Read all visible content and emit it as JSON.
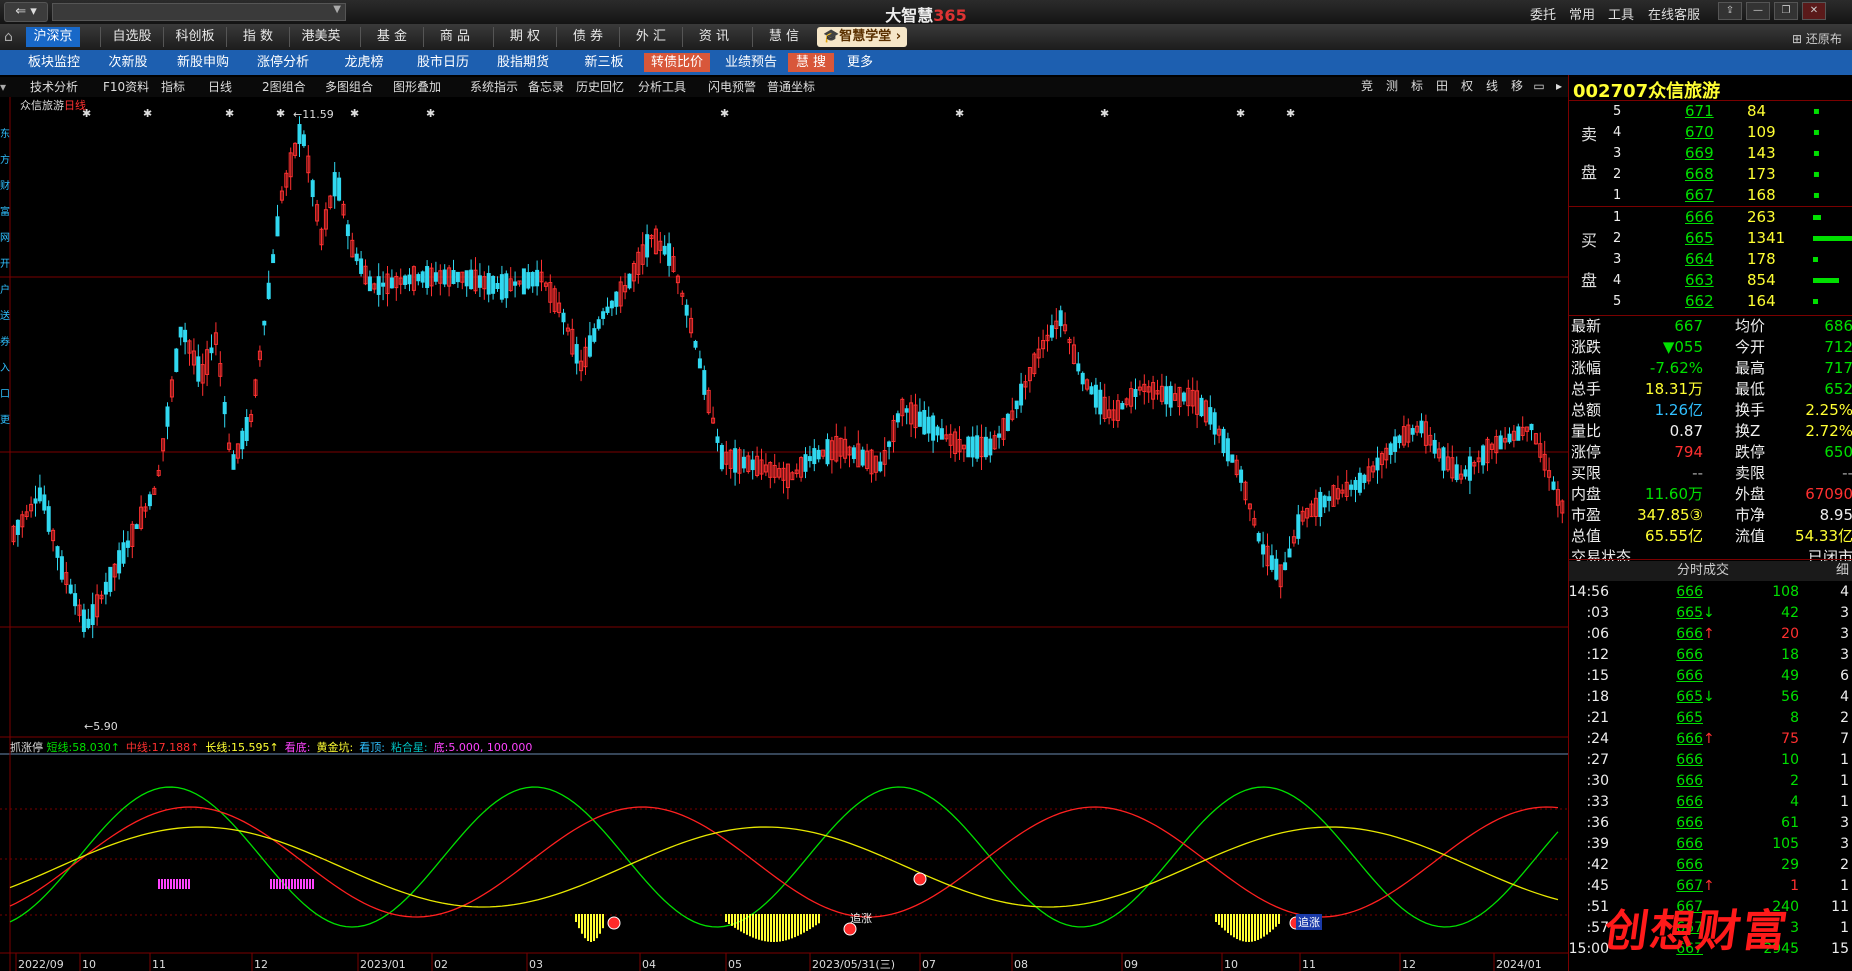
{
  "titlebar": {
    "app_name_prefix": "大智慧",
    "app_name_num": "365",
    "right_links": [
      "委托",
      "常用",
      "工具",
      "在线客服"
    ],
    "layout_btn": "还原布局"
  },
  "mainmenu": {
    "items": [
      "沪深京",
      "自选股",
      "科创板",
      "指 数",
      "港美英",
      "基 金",
      "商 品",
      "期 权",
      "债 券",
      "外 汇",
      "资 讯",
      "慧 信"
    ],
    "edu": "智慧学堂"
  },
  "submenu": {
    "items": [
      "板块监控",
      "次新股",
      "新股申购",
      "涨停分析",
      "龙虎榜",
      "股市日历",
      "股指期货",
      "新三板",
      "转债比价",
      "业绩预告",
      "慧 搜",
      "更多"
    ]
  },
  "toolbar": {
    "items": [
      "技术分析",
      "F10资料",
      "指标",
      "日线",
      "2图组合",
      "多图组合",
      "图形叠加",
      "系统指示",
      "备忘录",
      "历史回忆",
      "分析工具",
      "闪电预警",
      "普通坐标"
    ],
    "right_items": [
      "竞",
      "测",
      "标",
      "田",
      "权",
      "线",
      "移"
    ]
  },
  "chart": {
    "stock_name": "众信旅游",
    "period": "日线",
    "high_label": "11.59",
    "low_label": "5.90",
    "indicator_name": "抓涨停",
    "indicator_items": [
      {
        "label": "短线:",
        "value": "58.030↑",
        "color": "#00e000"
      },
      {
        "label": "中线:",
        "value": "17.188↑",
        "color": "#ff3030"
      },
      {
        "label": "长线:",
        "value": "15.595↑",
        "color": "#ffff33"
      },
      {
        "label": "看底:",
        "value": "",
        "color": "#ff44ff"
      },
      {
        "label": "黄金坑:",
        "value": "",
        "color": "#ffff33"
      },
      {
        "label": "看顶:",
        "value": "",
        "color": "#30c0ff"
      },
      {
        "label": "粘合星:",
        "value": "",
        "color": "#00c0c0"
      },
      {
        "label": "底:",
        "value": "5.000, 100.000",
        "color": "#ff44ff"
      }
    ],
    "annotations": [
      "追涨",
      "追涨"
    ],
    "date_labels": [
      "2022/09",
      "10",
      "11",
      "12",
      "2023/01",
      "02",
      "03",
      "04",
      "05",
      "2023/05/31(三)",
      "07",
      "08",
      "09",
      "10",
      "11",
      "12",
      "2024/01"
    ],
    "left_axis_fragments": [
      "东",
      "方",
      "财",
      "富",
      "网",
      "开",
      "户",
      "送",
      "券",
      "入",
      "口",
      "更"
    ]
  },
  "quote": {
    "code": "002707",
    "name": "众信旅游",
    "sell_label": [
      "卖",
      "盘"
    ],
    "buy_label": [
      "买",
      "盘"
    ],
    "sell": [
      {
        "lvl": "5",
        "price": "671",
        "vol": "84"
      },
      {
        "lvl": "4",
        "price": "670",
        "vol": "109"
      },
      {
        "lvl": "3",
        "price": "669",
        "vol": "143"
      },
      {
        "lvl": "2",
        "price": "668",
        "vol": "173"
      },
      {
        "lvl": "1",
        "price": "667",
        "vol": "168"
      }
    ],
    "buy": [
      {
        "lvl": "1",
        "price": "666",
        "vol": "263",
        "bar": 0.2
      },
      {
        "lvl": "2",
        "price": "665",
        "vol": "1341",
        "bar": 1.0
      },
      {
        "lvl": "3",
        "price": "664",
        "vol": "178",
        "bar": 0.13
      },
      {
        "lvl": "4",
        "price": "663",
        "vol": "854",
        "bar": 0.64
      },
      {
        "lvl": "5",
        "price": "662",
        "vol": "164",
        "bar": 0.12
      }
    ],
    "stats": [
      {
        "l1": "最新",
        "v1": "667",
        "c1": "green",
        "l2": "均价",
        "v2": "686",
        "c2": "green"
      },
      {
        "l1": "涨跌",
        "v1": "▼055",
        "c1": "green",
        "l2": "今开",
        "v2": "712",
        "c2": "green"
      },
      {
        "l1": "涨幅",
        "v1": "-7.62%",
        "c1": "green",
        "l2": "最高",
        "v2": "717",
        "c2": "green"
      },
      {
        "l1": "总手",
        "v1": "18.31万",
        "c1": "yellow",
        "l2": "最低",
        "v2": "652",
        "c2": "green"
      },
      {
        "l1": "总额",
        "v1": "1.26亿",
        "c1": "cyan",
        "l2": "换手",
        "v2": "2.25%",
        "c2": "yellow"
      },
      {
        "l1": "量比",
        "v1": "0.87",
        "c1": "white",
        "l2": "换Z",
        "v2": "2.72%",
        "c2": "yellow"
      },
      {
        "l1": "涨停",
        "v1": "794",
        "c1": "red",
        "l2": "跌停",
        "v2": "650",
        "c2": "green"
      },
      {
        "l1": "买限",
        "v1": "--",
        "c1": "gray",
        "l2": "卖限",
        "v2": "--",
        "c2": "gray"
      },
      {
        "l1": "内盘",
        "v1": "11.60万",
        "c1": "green",
        "l2": "外盘",
        "v2": "67090",
        "c2": "red"
      },
      {
        "l1": "市盈",
        "v1": "347.85③",
        "c1": "yellow",
        "l2": "市净",
        "v2": "8.95",
        "c2": "white"
      },
      {
        "l1": "总值",
        "v1": "65.55亿",
        "c1": "yellow",
        "l2": "流值",
        "v2": "54.33亿",
        "c2": "yellow"
      },
      {
        "l1": "交易状态",
        "v1": "",
        "c1": "white",
        "l2": "",
        "v2": "已闭市",
        "c2": "white"
      }
    ],
    "ticks_header": "分时成交",
    "ticks_tab": "细",
    "ticks": [
      {
        "t": "14:56",
        "p": "666",
        "d": "",
        "v": "108",
        "vc": "green",
        "n": "4"
      },
      {
        "t": ":03",
        "p": "665",
        "d": "↓",
        "v": "42",
        "vc": "green",
        "n": "3"
      },
      {
        "t": ":06",
        "p": "666",
        "d": "↑",
        "v": "20",
        "vc": "red",
        "n": "3"
      },
      {
        "t": ":12",
        "p": "666",
        "d": "",
        "v": "18",
        "vc": "green",
        "n": "3"
      },
      {
        "t": ":15",
        "p": "666",
        "d": "",
        "v": "49",
        "vc": "green",
        "n": "6"
      },
      {
        "t": ":18",
        "p": "665",
        "d": "↓",
        "v": "56",
        "vc": "green",
        "n": "4"
      },
      {
        "t": ":21",
        "p": "665",
        "d": "",
        "v": "8",
        "vc": "green",
        "n": "2"
      },
      {
        "t": ":24",
        "p": "666",
        "d": "↑",
        "v": "75",
        "vc": "red",
        "n": "7"
      },
      {
        "t": ":27",
        "p": "666",
        "d": "",
        "v": "10",
        "vc": "green",
        "n": "1"
      },
      {
        "t": ":30",
        "p": "666",
        "d": "",
        "v": "2",
        "vc": "green",
        "n": "1"
      },
      {
        "t": ":33",
        "p": "666",
        "d": "",
        "v": "4",
        "vc": "green",
        "n": "1"
      },
      {
        "t": ":36",
        "p": "666",
        "d": "",
        "v": "61",
        "vc": "green",
        "n": "3"
      },
      {
        "t": ":39",
        "p": "666",
        "d": "",
        "v": "105",
        "vc": "green",
        "n": "3"
      },
      {
        "t": ":42",
        "p": "666",
        "d": "",
        "v": "29",
        "vc": "green",
        "n": "2"
      },
      {
        "t": ":45",
        "p": "667",
        "d": "↑",
        "v": "1",
        "vc": "red",
        "n": "1"
      },
      {
        "t": ":51",
        "p": "667",
        "d": "",
        "v": "240",
        "vc": "green",
        "n": "11"
      },
      {
        "t": ":57",
        "p": "667",
        "d": "",
        "v": "3",
        "vc": "green",
        "n": "1"
      },
      {
        "t": "15:00",
        "p": "667",
        "d": "",
        "v": "2945",
        "vc": "green",
        "n": "15"
      }
    ]
  },
  "watermark": "创想财富",
  "colors": {
    "up": "#ff3030",
    "down": "#30d8f0",
    "grid": "#7a0000",
    "short": "#00e000",
    "mid": "#ff2020",
    "long": "#e8e800"
  }
}
